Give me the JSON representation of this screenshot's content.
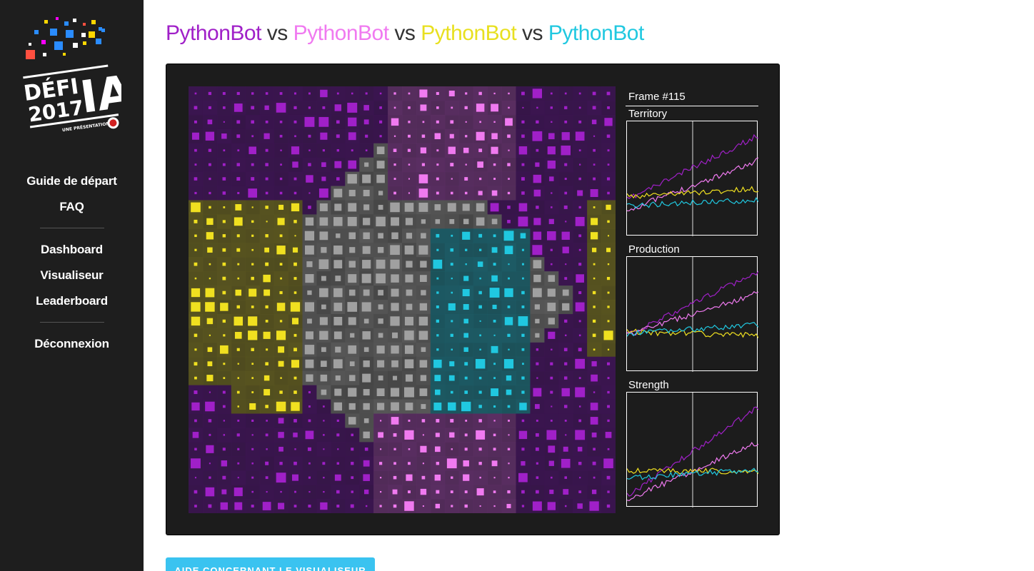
{
  "sidebar": {
    "logo": {
      "line1": "DÉFI",
      "line2": "2017",
      "big": "IA",
      "tagline": "UNE PRÉSENTATION DE"
    },
    "nav_primary": [
      "Guide de départ",
      "FAQ"
    ],
    "nav_secondary": [
      "Dashboard",
      "Visualiseur",
      "Leaderboard"
    ],
    "nav_tertiary": [
      "Déconnexion"
    ]
  },
  "match": {
    "players": [
      {
        "name": "PythonBot",
        "color": "#a020c8"
      },
      {
        "name": "PythonBot",
        "color": "#f07af0"
      },
      {
        "name": "PythonBot",
        "color": "#f0e020"
      },
      {
        "name": "PythonBot",
        "color": "#20c8e0"
      }
    ],
    "separator": "vs"
  },
  "visualizer": {
    "frame_label": "Frame #115",
    "stats": [
      {
        "title": "Territory"
      },
      {
        "title": "Production"
      },
      {
        "title": "Strength"
      }
    ]
  },
  "help_button": "AIDE CONCERNANT LE VISUALISEUR",
  "colors": {
    "sidebar_bg": "#1e1e1e",
    "viz_bg": "#1c1c1c",
    "neutral": "#5a5a5a",
    "player1_territory": "#4a1a6a",
    "player2_territory": "#6a3a6a",
    "player3_territory": "#6a6320",
    "player4_territory": "#1f6a75",
    "button": "#3ac3f0"
  }
}
